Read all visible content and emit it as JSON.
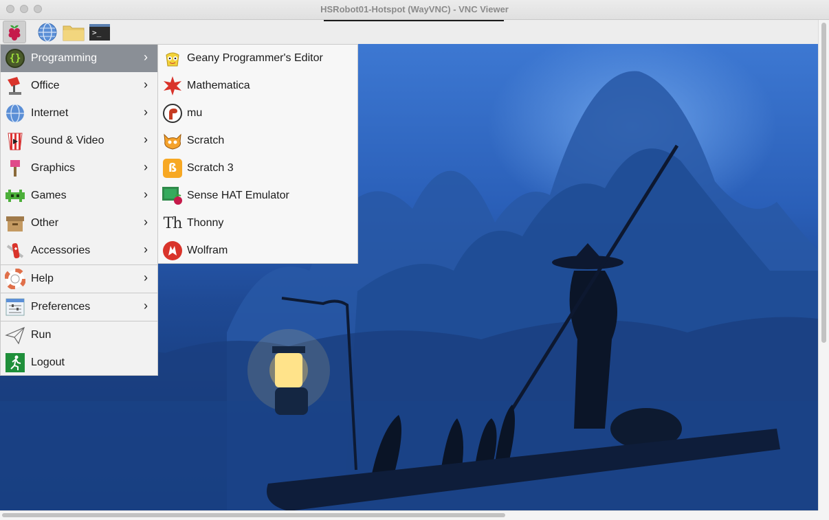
{
  "window": {
    "title": "HSRobot01-Hotspot (WayVNC) - VNC Viewer"
  },
  "taskbar": {
    "items": [
      {
        "icon": "raspberry-icon"
      },
      {
        "icon": "globe-icon"
      },
      {
        "icon": "folder-icon"
      },
      {
        "icon": "terminal-icon",
        "text": ">_"
      }
    ]
  },
  "menu": {
    "items": [
      {
        "label": "Programming",
        "icon": "programming-icon",
        "submenu": true,
        "active": true
      },
      {
        "label": "Office",
        "icon": "office-icon",
        "submenu": true
      },
      {
        "label": "Internet",
        "icon": "internet-icon",
        "submenu": true
      },
      {
        "label": "Sound & Video",
        "icon": "sound-video-icon",
        "submenu": true
      },
      {
        "label": "Graphics",
        "icon": "graphics-icon",
        "submenu": true
      },
      {
        "label": "Games",
        "icon": "games-icon",
        "submenu": true
      },
      {
        "label": "Other",
        "icon": "other-icon",
        "submenu": true
      },
      {
        "label": "Accessories",
        "icon": "accessories-icon",
        "submenu": true
      },
      {
        "label": "Help",
        "icon": "help-icon",
        "submenu": true
      },
      {
        "label": "Preferences",
        "icon": "preferences-icon",
        "submenu": true
      },
      {
        "label": "Run",
        "icon": "run-icon",
        "submenu": false
      },
      {
        "label": "Logout",
        "icon": "logout-icon",
        "submenu": false
      }
    ]
  },
  "submenu": {
    "items": [
      {
        "label": "Geany Programmer's Editor",
        "icon": "geany-icon"
      },
      {
        "label": "Mathematica",
        "icon": "mathematica-icon"
      },
      {
        "label": "mu",
        "icon": "mu-icon"
      },
      {
        "label": "Scratch",
        "icon": "scratch-icon"
      },
      {
        "label": "Scratch 3",
        "icon": "scratch3-icon"
      },
      {
        "label": "Sense HAT Emulator",
        "icon": "sense-hat-icon"
      },
      {
        "label": "Thonny",
        "icon": "thonny-icon",
        "glyph": "Th"
      },
      {
        "label": "Wolfram",
        "icon": "wolfram-icon"
      }
    ]
  },
  "colors": {
    "menu_active": "#8a8f96",
    "desktop_top": "#3d78d2",
    "desktop_bottom": "#122f66"
  }
}
